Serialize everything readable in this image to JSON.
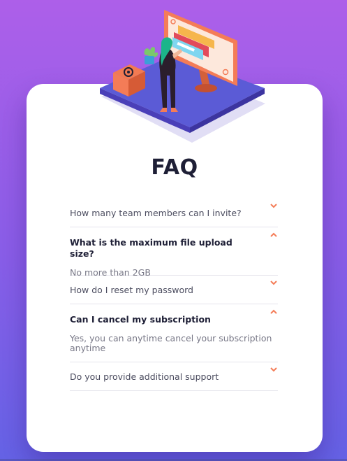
{
  "title": "FAQ",
  "colors": {
    "background_top": "#ad5fe9",
    "background_bottom": "#6563e6",
    "card": "#ffffff",
    "title": "#1e1f36",
    "accent": "#f47c57",
    "divider": "#e5e4ec"
  },
  "illustration": {
    "description_icon": "woman-at-monitor-illustration"
  },
  "faq": [
    {
      "question": "How many team members can I invite?",
      "expanded": false,
      "answer": ""
    },
    {
      "question": "What is the maximum file upload size?",
      "expanded": true,
      "answer": "No more than 2GB"
    },
    {
      "question": "How do I reset my password",
      "expanded": false,
      "answer": ""
    },
    {
      "question": "Can I cancel my subscription",
      "expanded": true,
      "answer": "Yes, you can anytime cancel your subscription anytime"
    },
    {
      "question": "Do you provide additional support",
      "expanded": false,
      "answer": ""
    }
  ]
}
